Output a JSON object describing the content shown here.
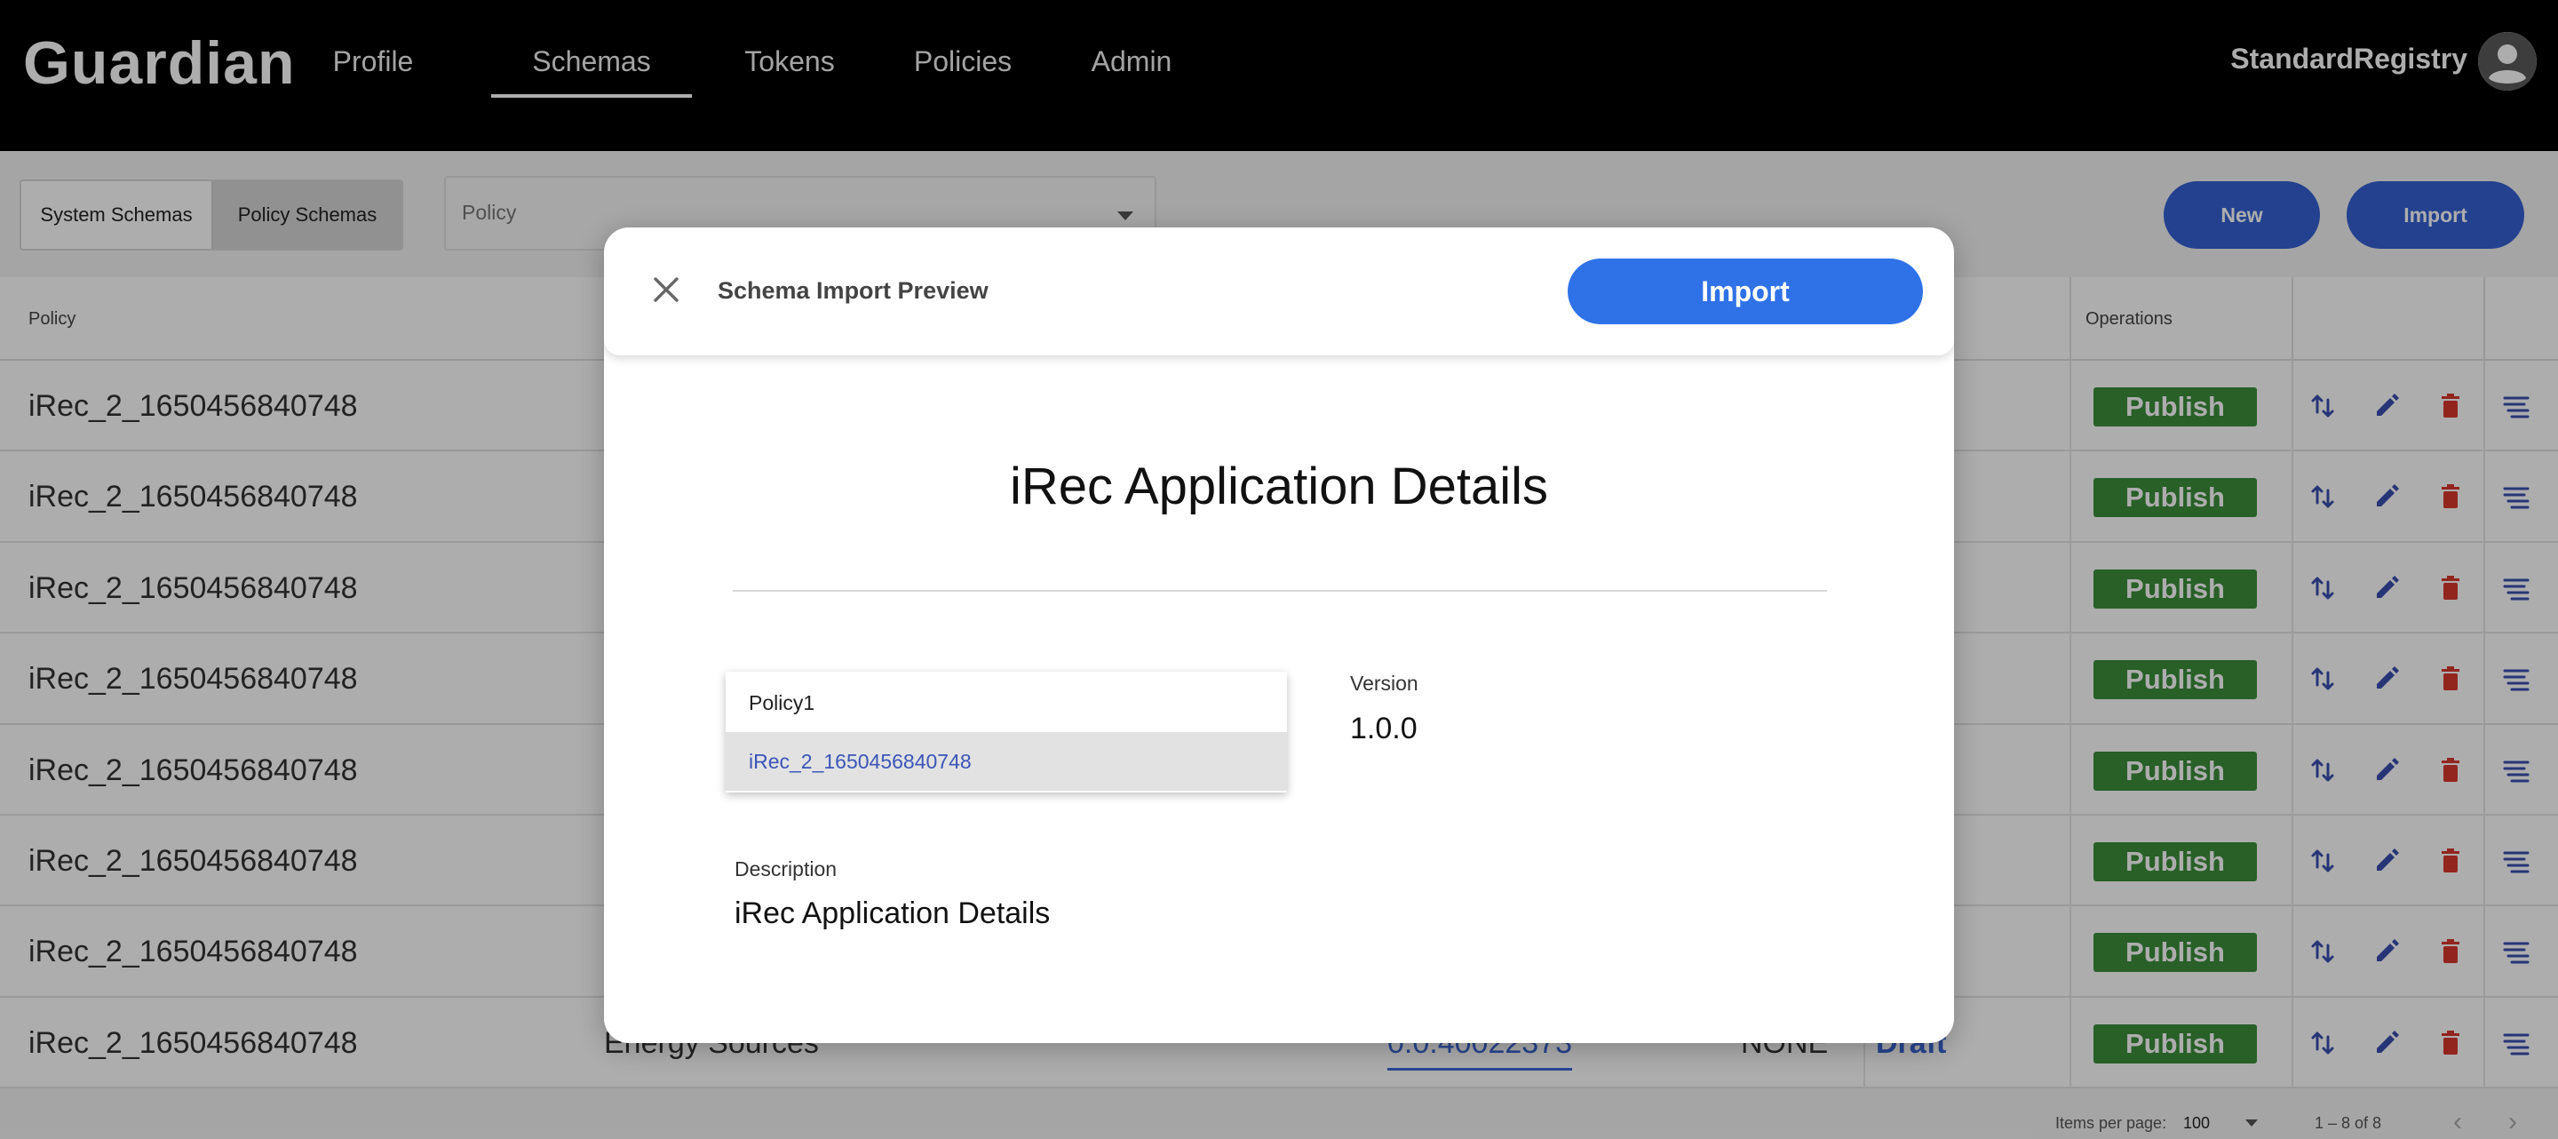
{
  "header": {
    "logo": "Guardian",
    "nav": [
      "Profile",
      "Schemas",
      "Tokens",
      "Policies",
      "Admin"
    ],
    "active_nav": "Schemas",
    "user": "StandardRegistry"
  },
  "toolbar": {
    "system_schemas": "System Schemas",
    "policy_schemas": "Policy Schemas",
    "policy_placeholder": "Policy",
    "new_label": "New",
    "import_label": "Import"
  },
  "table": {
    "headers": {
      "policy": "Policy",
      "operations": "Operations"
    },
    "rows": [
      {
        "policy": "iRec_2_1650456840748",
        "publish": "Publish"
      },
      {
        "policy": "iRec_2_1650456840748",
        "publish": "Publish"
      },
      {
        "policy": "iRec_2_1650456840748",
        "publish": "Publish"
      },
      {
        "policy": "iRec_2_1650456840748",
        "publish": "Publish"
      },
      {
        "policy": "iRec_2_1650456840748",
        "publish": "Publish"
      },
      {
        "policy": "iRec_2_1650456840748",
        "publish": "Publish"
      },
      {
        "policy": "iRec_2_1650456840748",
        "publish": "Publish"
      },
      {
        "policy": "iRec_2_1650456840748",
        "name": "Energy Sources",
        "version": "0.0.40022373",
        "topic": "NONE",
        "status": "Draft",
        "publish": "Publish"
      }
    ]
  },
  "paginator": {
    "items_per_page_label": "Items per page:",
    "items_per_page": "100",
    "range": "1 – 8 of 8"
  },
  "dialog": {
    "title": "Schema Import Preview",
    "import_label": "Import",
    "schema_name": "iRec Application Details",
    "version_label": "Version",
    "version": "1.0.0",
    "description_label": "Description",
    "description": "iRec Application Details",
    "policy_options": [
      "Policy1",
      "iRec_2_1650456840748"
    ],
    "selected_policy": "iRec_2_1650456840748"
  },
  "colors": {
    "accent": "#3461d3",
    "publish": "#3c8e3c",
    "delete": "#d9372f",
    "dialog_import": "#2f72e8"
  }
}
